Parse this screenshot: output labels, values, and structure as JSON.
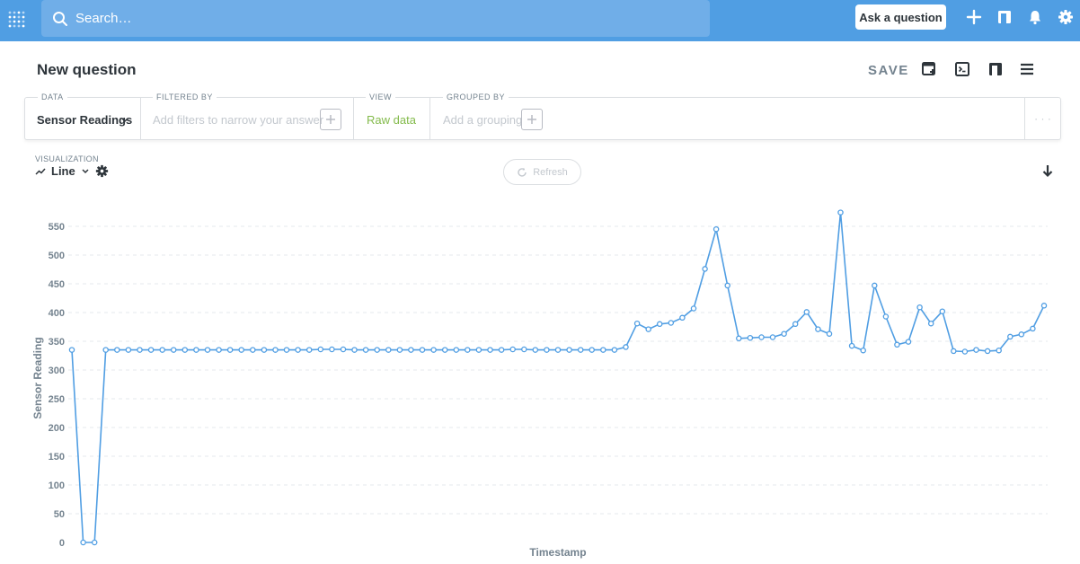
{
  "nav": {
    "search_placeholder": "Search…",
    "ask_label": "Ask a question",
    "icons": [
      "plus-icon",
      "bookmark-icon",
      "bell-icon",
      "gear-icon"
    ]
  },
  "header": {
    "title": "New question",
    "save_label": "SAVE",
    "icons": [
      "new-notebook-icon",
      "sql-icon",
      "bookmark-icon",
      "menu-icon"
    ]
  },
  "query_builder": {
    "data": {
      "label": "DATA",
      "value": "Sensor Readings"
    },
    "filtered_by": {
      "label": "FILTERED BY",
      "placeholder": "Add filters to narrow your answer"
    },
    "view": {
      "label": "VIEW",
      "value": "Raw data"
    },
    "grouped_by": {
      "label": "GROUPED BY",
      "placeholder": "Add a grouping"
    },
    "more": "· · ·"
  },
  "visualization": {
    "label": "VISUALIZATION",
    "type_label": "Line",
    "refresh_label": "Refresh"
  },
  "colors": {
    "brand": "#509ee3",
    "line": "#509ee3",
    "green": "#84bb4c"
  },
  "chart_data": {
    "type": "line",
    "xlabel": "Timestamp",
    "ylabel": "Sensor Reading",
    "ylim": [
      0,
      570
    ],
    "yticks": [
      0,
      50,
      100,
      150,
      200,
      250,
      300,
      350,
      400,
      450,
      500,
      550
    ],
    "grid": true,
    "series": [
      {
        "values": [
          335,
          0,
          0,
          335,
          335,
          335,
          335,
          335,
          335,
          335,
          335,
          335,
          335,
          335,
          335,
          335,
          335,
          335,
          335,
          335,
          335,
          335,
          336,
          336,
          336,
          335,
          335,
          335,
          335,
          335,
          335,
          335,
          335,
          335,
          335,
          335,
          335,
          335,
          335,
          336,
          336,
          335,
          335,
          335,
          335,
          335,
          335,
          335,
          335,
          340,
          381,
          371,
          380,
          382,
          391,
          407,
          476,
          545,
          447,
          355,
          356,
          357,
          357,
          363,
          380,
          401,
          371,
          363,
          574,
          342,
          334,
          447,
          393,
          344,
          349,
          409,
          381,
          402,
          333,
          332,
          335,
          333,
          334,
          358,
          362,
          372,
          412
        ]
      }
    ]
  }
}
